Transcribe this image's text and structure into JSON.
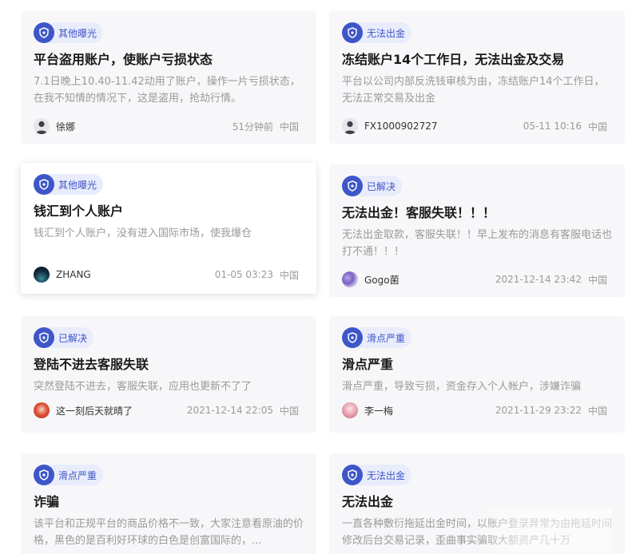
{
  "cards": [
    {
      "tag": "其他曝光",
      "title": "平台盗用账户，使账户亏损状态",
      "desc": "7.1日晚上10.40-11.42动用了账户，操作一片亏损状态，在我不知情的情况下，这是盗用，抢劫行情。",
      "user": "徐娜",
      "time": "51分钟前",
      "region": "中国",
      "avatar": "default-avatar-icon"
    },
    {
      "tag": "无法出金",
      "title": "冻结账户14个工作日，无法出金及交易",
      "desc": "平台以公司内部反洗钱审核为由，冻结账户14个工作日，无法正常交易及出金",
      "user": "FX1000902727",
      "time": "05-11 10:16",
      "region": "中国",
      "avatar": "default-avatar-icon"
    },
    {
      "tag": "其他曝光",
      "title": "钱汇到个人账户",
      "desc": "钱汇到个人账户，没有进入国际市场，使我爆仓",
      "user": "ZHANG",
      "time": "01-05 03:23",
      "region": "中国",
      "avatar": "night-sky-avatar"
    },
    {
      "tag": "已解决",
      "title": "无法出金！客服失联！！！",
      "desc": "无法出金取款，客服失联！！早上发布的消息有客服电话也打不通！！！",
      "user": "Gogo菌",
      "time": "2021-12-14 23:42",
      "region": "中国",
      "avatar": "flower-avatar"
    },
    {
      "tag": "已解决",
      "title": "登陆不进去客服失联",
      "desc": "突然登陆不进去，客服失联，应用也更新不了了",
      "user": "这一刻后天就晴了",
      "time": "2021-12-14 22:05",
      "region": "中国",
      "avatar": "red-avatar"
    },
    {
      "tag": "滑点严重",
      "title": "滑点严重",
      "desc": "滑点严重，导致亏损，资金存入个人帐户，涉嫌诈骗",
      "user": "李一梅",
      "time": "2021-11-29 23:22",
      "region": "中国",
      "avatar": "pink-avatar"
    },
    {
      "tag": "滑点严重",
      "title": "诈骗",
      "desc": "该平台和正规平台的商品价格不一致，大家注意看原油的价格，黑色的是百利好环球的白色是创富国际的，...",
      "user": "",
      "time": "",
      "region": "",
      "avatar": ""
    },
    {
      "tag": "无法出金",
      "title": "无法出金",
      "desc": "一直各种敷衍拖延出金时间，以账户登录异常为由拖延时间修改后台交易记录，歪曲事实骗取大额资产几十万",
      "user": "",
      "time": "",
      "region": "",
      "avatar": ""
    }
  ],
  "colors": {
    "accent": "#3e56c8",
    "tag_bg": "#e9ecfb",
    "card_bg": "#f7f7f9",
    "title": "#1a1a1a",
    "muted": "#9a9a9a"
  }
}
